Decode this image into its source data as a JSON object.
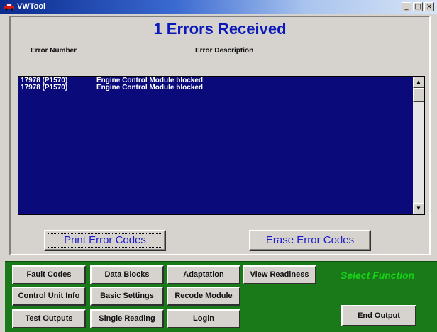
{
  "window": {
    "title": "VWTool",
    "minimize": "_",
    "restore": "□",
    "close": "×"
  },
  "main": {
    "heading": "1 Errors Received",
    "columns": {
      "number": "Error Number",
      "description": "Error Description"
    },
    "rows": [
      {
        "number": "17978 (P1570)",
        "description": "Engine Control Module blocked"
      },
      {
        "number": "17978 (P1570)",
        "description": "Engine Control Module blocked"
      }
    ],
    "print_button": "Print Error Codes",
    "erase_button": "Erase Error Codes"
  },
  "functions": {
    "fault_codes": "Fault Codes",
    "data_blocks": "Data Blocks",
    "adaptation": "Adaptation",
    "view_readiness": "View Readiness",
    "control_unit_info": "Control Unit Info",
    "basic_settings": "Basic Settings",
    "recode_module": "Recode Module",
    "test_outputs": "Test Outputs",
    "single_reading": "Single Reading",
    "login": "Login",
    "select_function": "Select Function",
    "end_output": "End Output"
  },
  "colors": {
    "accent_text": "#0b19b9",
    "list_bg": "#0a0a7a",
    "panel_green": "#1a7a1a",
    "select_fn": "#1ad11a"
  }
}
